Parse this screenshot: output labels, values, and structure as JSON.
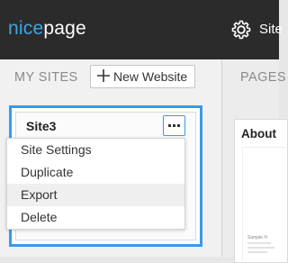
{
  "app": {
    "logo_part1": "nice",
    "logo_part2": "page"
  },
  "header": {
    "settings_label": "Site"
  },
  "sites_panel": {
    "heading": "MY SITES",
    "new_site_button": "New Website",
    "site_card": {
      "name": "Site3"
    },
    "menu": {
      "items": [
        {
          "label": "Site Settings"
        },
        {
          "label": "Duplicate"
        },
        {
          "label": "Export",
          "highlighted": true
        },
        {
          "label": "Delete"
        }
      ]
    }
  },
  "pages_panel": {
    "heading": "PAGES",
    "page_title": "About",
    "thumbnail_text": "Sample H"
  },
  "colors": {
    "topbar": "#2b2b2b",
    "accent": "#3aa6e8",
    "selection": "#3f97e8"
  }
}
